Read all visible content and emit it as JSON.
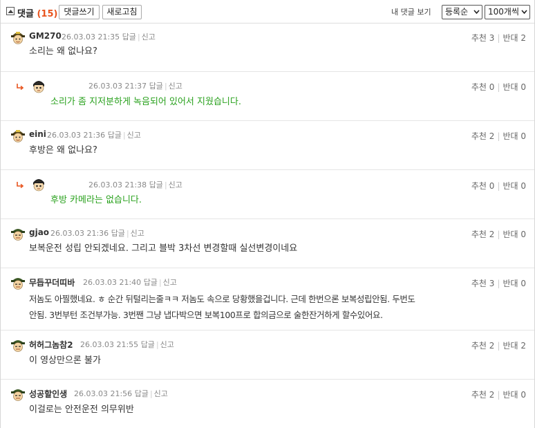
{
  "toolbar": {
    "title": "댓글",
    "count": "(15)",
    "write_button": "댓글쓰기",
    "refresh_button": "새로고침",
    "my_comments": "내 댓글 보기",
    "sort_select": "등록순",
    "page_size_select": "100개씩"
  },
  "labels": {
    "reply": "답글",
    "report": "신고",
    "up": "추천",
    "down": "반대"
  },
  "comments": [
    {
      "author": "GM270",
      "time": "26.03.03 21:35",
      "text": "소리는 왜 없나요?",
      "up": "3",
      "down": "2",
      "reply": false
    },
    {
      "author": "",
      "time": "26.03.03 21:37",
      "text": "소리가 좀 지저분하게 녹음되어 있어서 지웠습니다.",
      "up": "0",
      "down": "0",
      "reply": true
    },
    {
      "author": "eini",
      "time": "26.03.03 21:36",
      "text": "후방은 왜 없나요?",
      "up": "2",
      "down": "0",
      "reply": false
    },
    {
      "author": "",
      "time": "26.03.03 21:38",
      "text": "후방 카메라는 없습니다.",
      "up": "0",
      "down": "0",
      "reply": true
    },
    {
      "author": "gjao",
      "time": "26.03.03 21:36",
      "text": "보복운전 성립 안되겠네요. 그리고 블박 3차선 변경할때 실선변경이네요",
      "up": "2",
      "down": "0",
      "reply": false
    },
    {
      "author": "무듭꾸더띠바",
      "time": "26.03.03 21:40",
      "text_line1": "저놈도 아찔했네요. ㅎ 순간 뒤털리는줄ㅋㅋ 저놈도 속으로 당황했을겁니다. 근데 한번으론 보복성립안됨. 두번도",
      "text_line2": "안됨. 3번부턴 조건부가능. 3번짼 그냥 냅다박으면 보복100프로 합의금으로 술한잔거하게 할수있어요.",
      "up": "3",
      "down": "0",
      "reply": false
    },
    {
      "author": "허허그놈참2",
      "time": "26.03.03 21:55",
      "text": "이 영상만으론 불가",
      "up": "2",
      "down": "2",
      "reply": false
    },
    {
      "author": "성공할인생",
      "time": "26.03.03 21:56",
      "text": "이걸로는 안전운전 의무위반",
      "up": "2",
      "down": "0",
      "reply": false
    }
  ],
  "colors": {
    "count": "#e8541e",
    "reply_text": "#29a11d",
    "reply_arrow": "#e8541e"
  },
  "icons": {
    "collapse": "collapse-minus-icon",
    "reply_arrow": "reply-arrow-icon",
    "avatar": "avatar-icon",
    "dropdown": "chevron-down-icon"
  }
}
